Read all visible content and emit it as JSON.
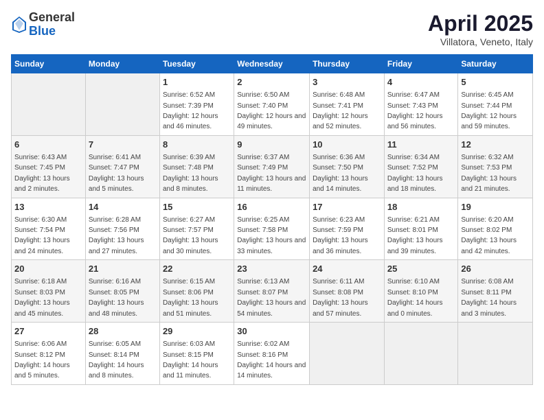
{
  "header": {
    "logo_general": "General",
    "logo_blue": "Blue",
    "month": "April 2025",
    "location": "Villatora, Veneto, Italy"
  },
  "days_of_week": [
    "Sunday",
    "Monday",
    "Tuesday",
    "Wednesday",
    "Thursday",
    "Friday",
    "Saturday"
  ],
  "weeks": [
    [
      null,
      null,
      {
        "day": 1,
        "sunrise": "6:52 AM",
        "sunset": "7:39 PM",
        "daylight": "12 hours and 46 minutes."
      },
      {
        "day": 2,
        "sunrise": "6:50 AM",
        "sunset": "7:40 PM",
        "daylight": "12 hours and 49 minutes."
      },
      {
        "day": 3,
        "sunrise": "6:48 AM",
        "sunset": "7:41 PM",
        "daylight": "12 hours and 52 minutes."
      },
      {
        "day": 4,
        "sunrise": "6:47 AM",
        "sunset": "7:43 PM",
        "daylight": "12 hours and 56 minutes."
      },
      {
        "day": 5,
        "sunrise": "6:45 AM",
        "sunset": "7:44 PM",
        "daylight": "12 hours and 59 minutes."
      }
    ],
    [
      {
        "day": 6,
        "sunrise": "6:43 AM",
        "sunset": "7:45 PM",
        "daylight": "13 hours and 2 minutes."
      },
      {
        "day": 7,
        "sunrise": "6:41 AM",
        "sunset": "7:47 PM",
        "daylight": "13 hours and 5 minutes."
      },
      {
        "day": 8,
        "sunrise": "6:39 AM",
        "sunset": "7:48 PM",
        "daylight": "13 hours and 8 minutes."
      },
      {
        "day": 9,
        "sunrise": "6:37 AM",
        "sunset": "7:49 PM",
        "daylight": "13 hours and 11 minutes."
      },
      {
        "day": 10,
        "sunrise": "6:36 AM",
        "sunset": "7:50 PM",
        "daylight": "13 hours and 14 minutes."
      },
      {
        "day": 11,
        "sunrise": "6:34 AM",
        "sunset": "7:52 PM",
        "daylight": "13 hours and 18 minutes."
      },
      {
        "day": 12,
        "sunrise": "6:32 AM",
        "sunset": "7:53 PM",
        "daylight": "13 hours and 21 minutes."
      }
    ],
    [
      {
        "day": 13,
        "sunrise": "6:30 AM",
        "sunset": "7:54 PM",
        "daylight": "13 hours and 24 minutes."
      },
      {
        "day": 14,
        "sunrise": "6:28 AM",
        "sunset": "7:56 PM",
        "daylight": "13 hours and 27 minutes."
      },
      {
        "day": 15,
        "sunrise": "6:27 AM",
        "sunset": "7:57 PM",
        "daylight": "13 hours and 30 minutes."
      },
      {
        "day": 16,
        "sunrise": "6:25 AM",
        "sunset": "7:58 PM",
        "daylight": "13 hours and 33 minutes."
      },
      {
        "day": 17,
        "sunrise": "6:23 AM",
        "sunset": "7:59 PM",
        "daylight": "13 hours and 36 minutes."
      },
      {
        "day": 18,
        "sunrise": "6:21 AM",
        "sunset": "8:01 PM",
        "daylight": "13 hours and 39 minutes."
      },
      {
        "day": 19,
        "sunrise": "6:20 AM",
        "sunset": "8:02 PM",
        "daylight": "13 hours and 42 minutes."
      }
    ],
    [
      {
        "day": 20,
        "sunrise": "6:18 AM",
        "sunset": "8:03 PM",
        "daylight": "13 hours and 45 minutes."
      },
      {
        "day": 21,
        "sunrise": "6:16 AM",
        "sunset": "8:05 PM",
        "daylight": "13 hours and 48 minutes."
      },
      {
        "day": 22,
        "sunrise": "6:15 AM",
        "sunset": "8:06 PM",
        "daylight": "13 hours and 51 minutes."
      },
      {
        "day": 23,
        "sunrise": "6:13 AM",
        "sunset": "8:07 PM",
        "daylight": "13 hours and 54 minutes."
      },
      {
        "day": 24,
        "sunrise": "6:11 AM",
        "sunset": "8:08 PM",
        "daylight": "13 hours and 57 minutes."
      },
      {
        "day": 25,
        "sunrise": "6:10 AM",
        "sunset": "8:10 PM",
        "daylight": "14 hours and 0 minutes."
      },
      {
        "day": 26,
        "sunrise": "6:08 AM",
        "sunset": "8:11 PM",
        "daylight": "14 hours and 3 minutes."
      }
    ],
    [
      {
        "day": 27,
        "sunrise": "6:06 AM",
        "sunset": "8:12 PM",
        "daylight": "14 hours and 5 minutes."
      },
      {
        "day": 28,
        "sunrise": "6:05 AM",
        "sunset": "8:14 PM",
        "daylight": "14 hours and 8 minutes."
      },
      {
        "day": 29,
        "sunrise": "6:03 AM",
        "sunset": "8:15 PM",
        "daylight": "14 hours and 11 minutes."
      },
      {
        "day": 30,
        "sunrise": "6:02 AM",
        "sunset": "8:16 PM",
        "daylight": "14 hours and 14 minutes."
      },
      null,
      null,
      null
    ]
  ]
}
